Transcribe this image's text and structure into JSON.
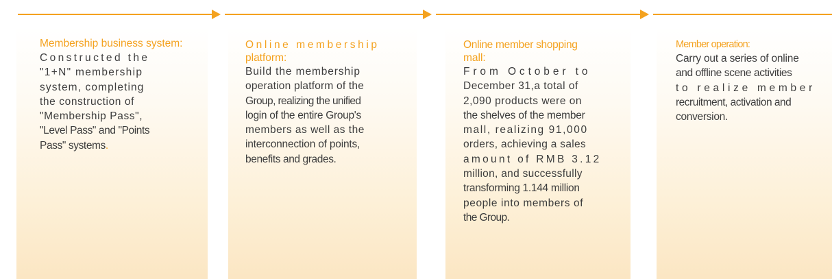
{
  "cards": [
    {
      "title": " Membership business system:",
      "body_lines": [
        "Constructed the",
        "\"1+N\" membership",
        "system, completing",
        "the construction of",
        "\"Membership Pass\",",
        "\"Level Pass\" and \"Points",
        "Pass\" systems"
      ],
      "body_end": "."
    },
    {
      "title_lines": [
        "Online membership",
        "platform:"
      ],
      "body_lines": [
        "Build the membership",
        "operation platform of the",
        "Group, realizing the unified",
        "login of the entire Group's",
        "members as well as the",
        "interconnection of points,",
        "benefits and grades."
      ]
    },
    {
      "title_lines": [
        "Online member shopping",
        "mall:"
      ],
      "body_lines": [
        "From October to",
        "December 31,a total of",
        "2,090 products were on",
        "the shelves of the member",
        "mall, realizing 91,000",
        "orders, achieving a sales",
        "amount of RMB 3.12",
        "million, and successfully",
        "transforming 1.144 million",
        "people into members of",
        "the Group."
      ]
    },
    {
      "title": "Member operation:",
      "body_lines": [
        "Carry out a series of online",
        "and offline scene activities",
        "to realize member",
        "recruitment, activation and",
        "conversion."
      ]
    }
  ],
  "colors": {
    "accent": "#f4a21f",
    "text": "#3d3d3d"
  }
}
